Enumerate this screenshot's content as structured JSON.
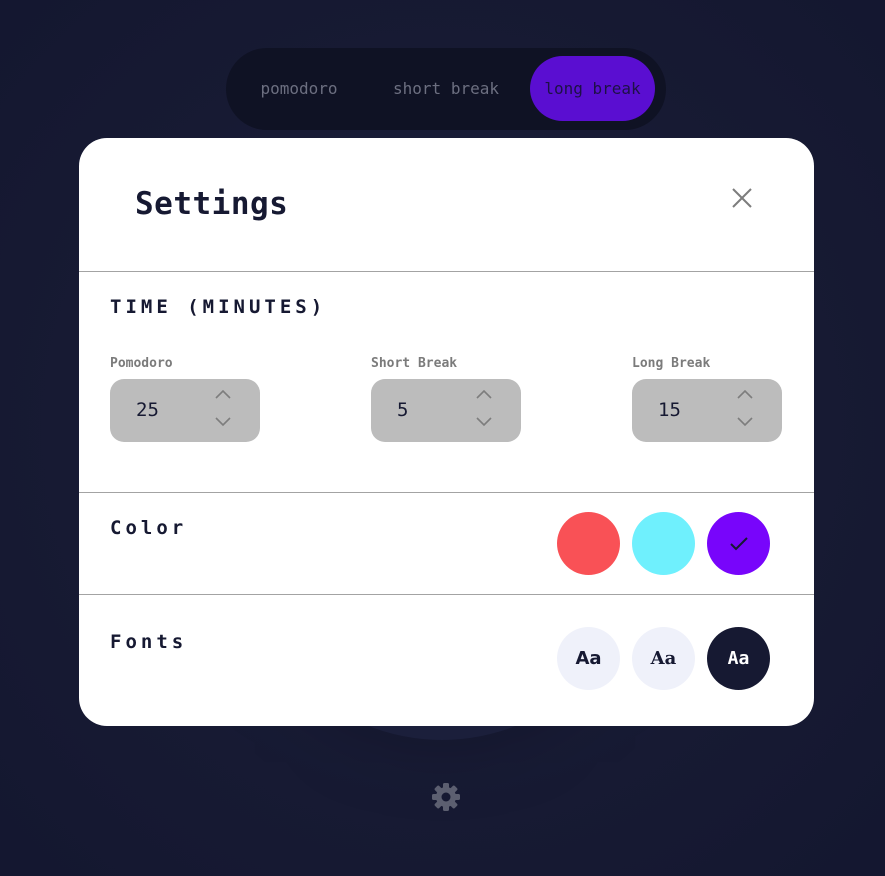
{
  "tabs": [
    {
      "label": "pomodoro"
    },
    {
      "label": "short break"
    },
    {
      "label": "long break",
      "active": true
    }
  ],
  "settings": {
    "title": "Settings",
    "close_icon": "close-icon",
    "time": {
      "heading": "TIME (MINUTES)",
      "fields": [
        {
          "label": "Pomodoro",
          "value": "25"
        },
        {
          "label": "Short Break",
          "value": "5"
        },
        {
          "label": "Long Break",
          "value": "15"
        }
      ]
    },
    "color": {
      "heading": "Color",
      "options": [
        {
          "name": "red",
          "hex": "#f95156"
        },
        {
          "name": "cyan",
          "hex": "#6ff0fd"
        },
        {
          "name": "purple",
          "hex": "#7805fb",
          "selected": true
        }
      ]
    },
    "fonts": {
      "heading": "Fonts",
      "options": [
        {
          "label": "Aa"
        },
        {
          "label": "Aa"
        },
        {
          "label": "Aa",
          "selected": true
        }
      ]
    }
  },
  "colors": {
    "background": "#161932",
    "accent": "#5a0ed1",
    "stepper_bg": "#bcbcbc",
    "font_option_bg": "#eff1fa"
  },
  "footer": {
    "settings_icon": "gear-icon"
  }
}
